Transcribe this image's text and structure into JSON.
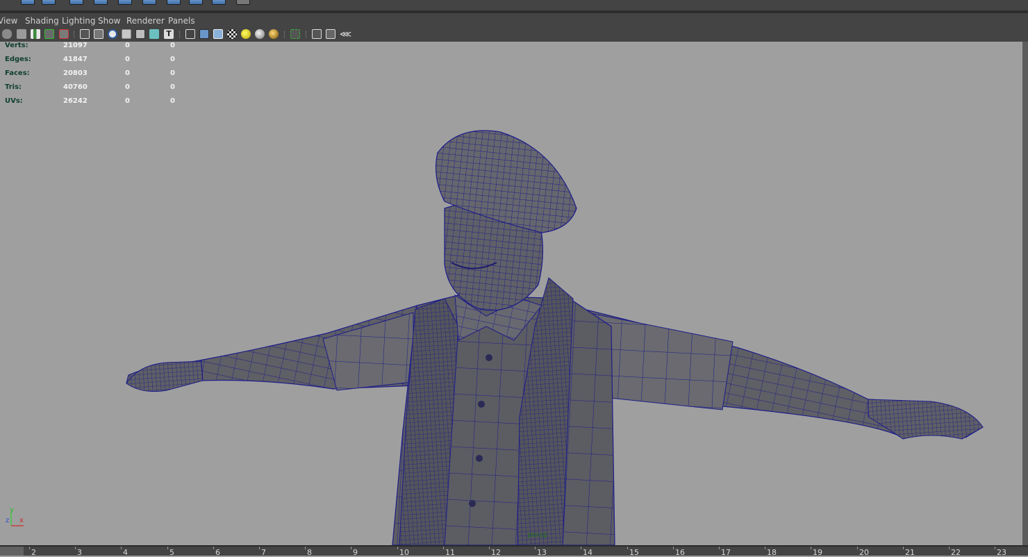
{
  "menus": [
    "View",
    "Shading",
    "Lighting",
    "Show",
    "Renderer",
    "Panels"
  ],
  "hud": {
    "rows": [
      {
        "label": "Verts:",
        "v1": "21097",
        "v2": "0",
        "v3": "0"
      },
      {
        "label": "Edges:",
        "v1": "41847",
        "v2": "0",
        "v3": "0"
      },
      {
        "label": "Faces:",
        "v1": "20803",
        "v2": "0",
        "v3": "0"
      },
      {
        "label": "Tris:",
        "v1": "40760",
        "v2": "0",
        "v3": "0"
      },
      {
        "label": "UVs:",
        "v1": "26242",
        "v2": "0",
        "v3": "0"
      }
    ]
  },
  "viewport": {
    "camera_label": "persp",
    "axis": {
      "y": "y",
      "z": "z",
      "x": "x"
    }
  },
  "timeline": {
    "frames": [
      "2",
      "3",
      "4",
      "5",
      "6",
      "7",
      "8",
      "9",
      "10",
      "11",
      "12",
      "13",
      "14",
      "15",
      "16",
      "17",
      "18",
      "19",
      "20",
      "21",
      "22",
      "23"
    ]
  },
  "colors": {
    "ui_dark": "#444444",
    "viewport_bg": "#9f9f9f",
    "mesh_fill": "#5f5f66",
    "wireframe": "#1a1a8c",
    "hud_label": "#0f3f2f"
  },
  "toolbar_icons": [
    "camera-attributes-icon",
    "camera-bookmark-icon",
    "image-plane-icon",
    "grid-toggle-icon",
    "film-gate-icon",
    "wireframe-shading-icon",
    "smooth-shading-icon",
    "default-material-icon",
    "xray-icon",
    "xray-joints-icon",
    "textured-icon",
    "wireframe-cube-icon",
    "smooth-cube-icon",
    "wireframe-on-shaded-icon",
    "checker-icon",
    "use-all-lights-icon",
    "default-light-icon",
    "shadows-icon",
    "isolate-select-icon",
    "frame-all-icon",
    "frame-selection-icon",
    "share-icon"
  ]
}
